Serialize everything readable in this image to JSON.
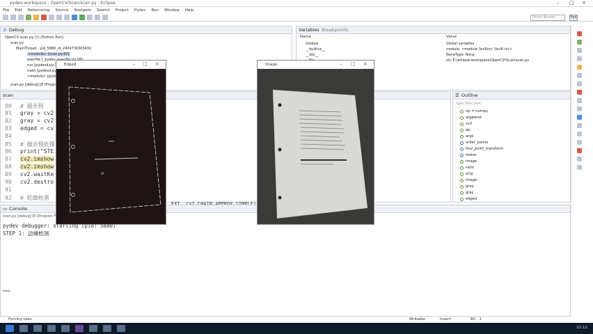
{
  "window": {
    "title": "pydev-workspace - OpenCV/Scan/scan.py - Eclipse"
  },
  "menu": [
    "File",
    "Edit",
    "Refactoring",
    "Source",
    "Navigate",
    "Search",
    "Project",
    "Pydev",
    "Run",
    "Window",
    "Help"
  ],
  "quick_access": {
    "placeholder": "Quick Access"
  },
  "perspective": {
    "label": "Pyd"
  },
  "debug": {
    "title": "Debug",
    "rows": [
      "OpenCV scan.py (1) [Python Run]",
      "scan.py",
      "MainThread - pid_5880_id_2404730303432",
      "<module> [scan.py:80]",
      "execfile [_pydev_execfile.py:18]",
      "run [pydevd.py:1068]",
      "main [pydevd.py:1735]",
      "<module> [pydevd.py:1741]",
      "scan.py [debug] [E:\\Program Files (x86)\\Anaconda3\\python.exe]"
    ]
  },
  "variables": {
    "tabs": [
      "Variables",
      "Breakpoints"
    ],
    "headers": [
      "Name",
      "Value"
    ],
    "rows": [
      {
        "name": "Globals",
        "value": "Global variables"
      },
      {
        "name": "__builtins__",
        "value": "module: <module 'builtins' (built-in)>"
      },
      {
        "name": "__doc__",
        "value": "NoneType: None"
      },
      {
        "name": "__file__",
        "value": "str: E:\\eclipse-workspace\\OpenCV\\Scan\\scan.py"
      }
    ]
  },
  "editor": {
    "tab": "scan",
    "lines": [
      {
        "n": "80",
        "text": "# 展示预"
      },
      {
        "n": "81",
        "text": "gray = cv2"
      },
      {
        "n": "82",
        "text": "gray = cv2"
      },
      {
        "n": "83",
        "text": "edged = cv"
      },
      {
        "n": "84",
        "text": ""
      },
      {
        "n": "85",
        "text": "# 展示预处理"
      },
      {
        "n": "86",
        "text": "print(\"STE"
      },
      {
        "n": "87",
        "text": "cv2.imshow"
      },
      {
        "n": "88",
        "text": "cv2.imshow"
      },
      {
        "n": "89",
        "text": "cv2.waitKe"
      },
      {
        "n": "90",
        "text": "cv2.destro"
      },
      {
        "n": "91",
        "text": ""
      },
      {
        "n": "92",
        "text": "# 轮廓检测"
      },
      {
        "n": "93",
        "text": "cnts = cv2"
      }
    ],
    "tail_text": "EXT, cv2.CHAIN_APPROX_SIMPLE)"
  },
  "outline": {
    "title": "Outline",
    "filter_placeholder": "type filter text",
    "items": [
      "np = numpy",
      "argparse",
      "cv2",
      "ap",
      "args",
      "order_points",
      "four_point_transform",
      "resize",
      "image",
      "ratio",
      "orig",
      "image",
      "gray",
      "gray",
      "edged"
    ]
  },
  "console": {
    "title": "Console",
    "subtitle": "scan.py [debug] [E:\\Program Files (x86)\\Anaconda3\\python.exe]",
    "lines": [
      "pydev debugger: starting (pid: 5880)",
      "STEP 1: 边缘检测"
    ],
    "prompt": ">>>"
  },
  "status": {
    "left": "Forcing tabs",
    "writable": "Writable",
    "insert": "Insert",
    "position": "80 : 1"
  },
  "windows": {
    "edged": "Edged",
    "image": "Image"
  },
  "taskbar": {
    "time": "22:12"
  }
}
